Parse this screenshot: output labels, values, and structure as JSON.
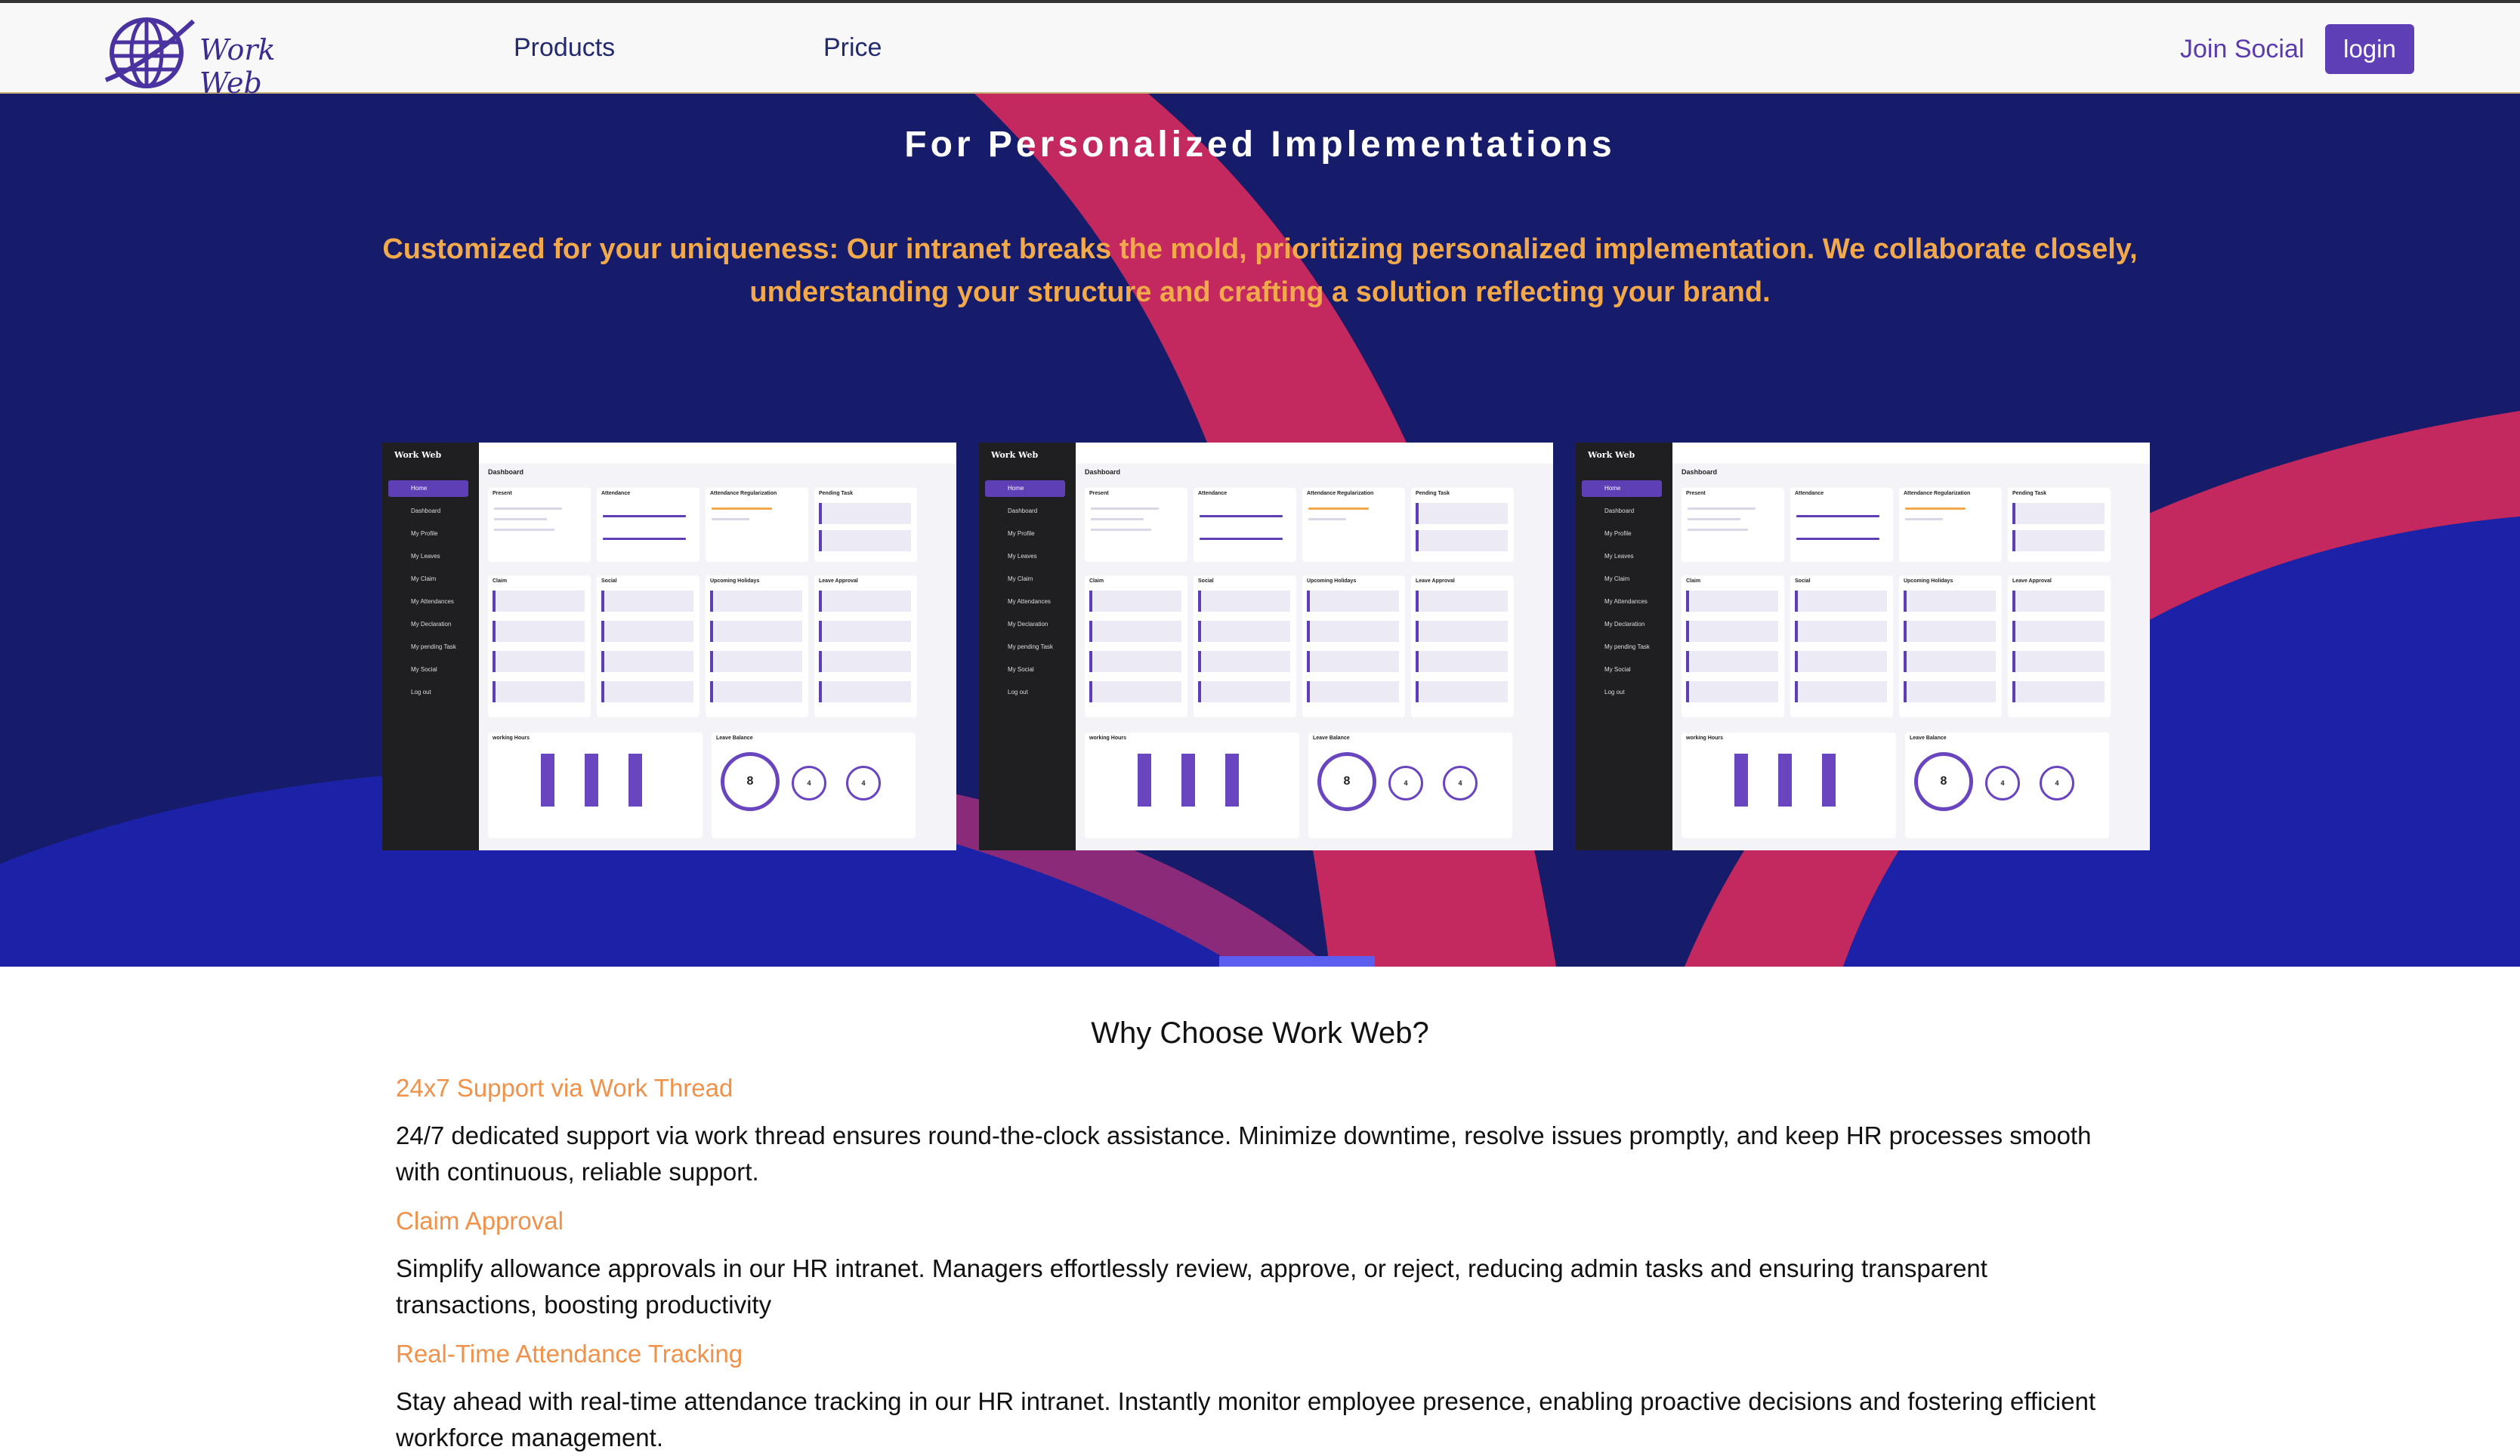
{
  "nav": {
    "logo_text": "Work Web",
    "products": "Products",
    "price": "Price",
    "join_social": "Join Social",
    "login": "login"
  },
  "hero": {
    "title": "For Personalized Implementations",
    "subtitle": "Customized for your uniqueness: Our intranet breaks the mold, prioritizing personalized implementation. We collaborate closely, understanding your structure and crafting a solution reflecting your brand."
  },
  "dashboard": {
    "brand": "Work Web",
    "heading": "Dashboard",
    "menu": [
      "Home",
      "Dashboard",
      "My Profile",
      "My Leaves",
      "My Claim",
      "My Attendances",
      "My Declaration",
      "My pending Task",
      "My Social",
      "Log out"
    ],
    "cards_row1": [
      "Present",
      "Attendance",
      "Attendance Regularization",
      "Pending Task"
    ],
    "cards_row2": [
      "Claim",
      "Social",
      "Upcoming Holidays",
      "Leave Approval"
    ],
    "working_hours": "working Hours",
    "leave_balance": "Leave Balance",
    "total_leave": "8",
    "sick_leave": "4",
    "casual_leave": "4"
  },
  "why": {
    "title": "Why Choose Work Web?",
    "features": [
      {
        "title": "24x7 Support via Work Thread",
        "desc": "24/7 dedicated support via work thread ensures round-the-clock assistance. Minimize downtime, resolve issues promptly, and keep HR processes smooth with continuous, reliable support."
      },
      {
        "title": "Claim Approval",
        "desc": "Simplify allowance approvals in our HR intranet. Managers effortlessly review, approve, or reject, reducing admin tasks and ensuring transparent transactions, boosting productivity"
      },
      {
        "title": "Real-Time Attendance Tracking",
        "desc": "Stay ahead with real-time attendance tracking in our HR intranet. Instantly monitor employee presence, enabling proactive decisions and fostering efficient workforce management."
      }
    ]
  },
  "colors": {
    "hero_bg": "#161b6a",
    "accent_pink": "#c3285e",
    "accent_blue": "#1c22a8",
    "brand_purple": "#5e3fb5",
    "orange": "#f0924a"
  }
}
